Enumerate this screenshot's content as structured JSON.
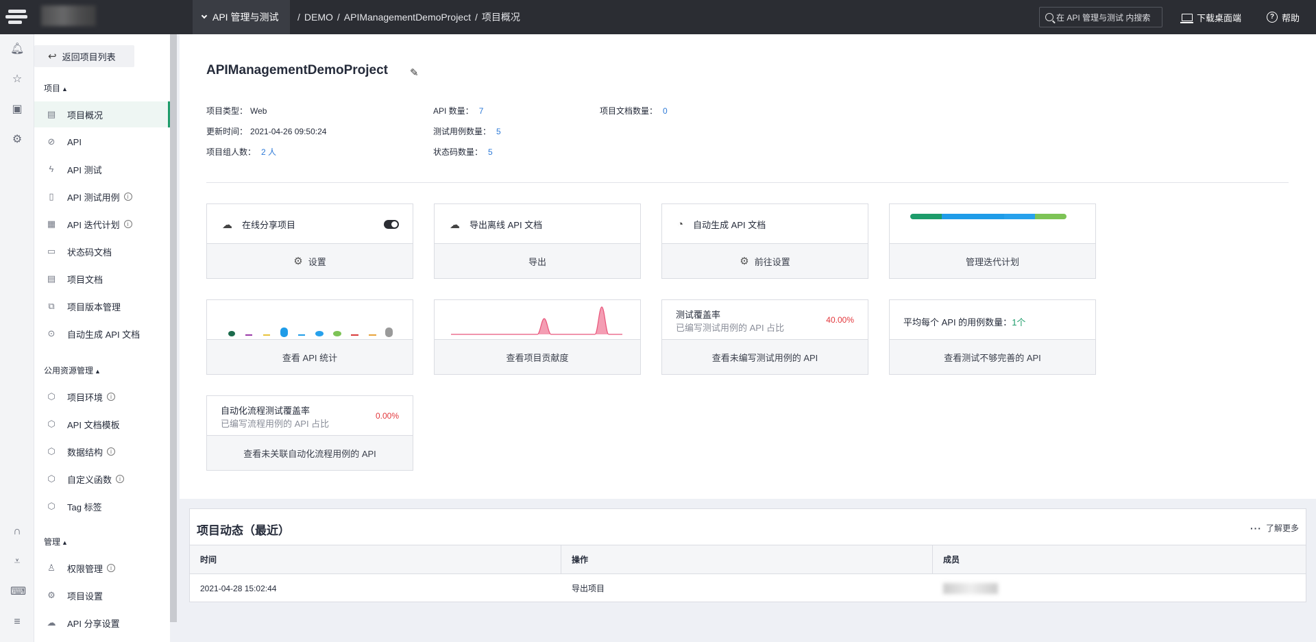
{
  "header": {
    "service": "API 管理与测试",
    "breadcrumb": [
      "DEMO",
      "APIManagementDemoProject",
      "项目概况"
    ],
    "search_placeholder": "在 API 管理与测试 内搜索",
    "download_label": "下载桌面端",
    "help_label": "帮助"
  },
  "rail_icons": [
    "bell-icon",
    "star-icon",
    "box-icon",
    "settings-icon",
    "headset-icon",
    "download-icon",
    "keyboard-icon",
    "menu-icon"
  ],
  "sidebar": {
    "back_label": "返回项目列表",
    "groups": [
      {
        "title": "项目",
        "items": [
          "项目概况",
          "API",
          "API 测试",
          "API 测试用例",
          "API 迭代计划",
          "状态码文档",
          "项目文档",
          "项目版本管理",
          "自动生成 API 文档"
        ]
      },
      {
        "title": "公用资源管理",
        "items": [
          "项目环境",
          "API 文档模板",
          "数据结构",
          "自定义函数",
          "Tag 标签"
        ]
      },
      {
        "title": "管理",
        "items": [
          "权限管理",
          "项目设置",
          "API 分享设置"
        ]
      }
    ],
    "active_item": "项目概况"
  },
  "project": {
    "name": "APIManagementDemoProject",
    "type_label": "项目类型：",
    "type_value": "Web",
    "updated_label": "更新时间：",
    "updated_value": "2021-04-26 09:50:24",
    "members_label": "项目组人数：",
    "members_value": "2 人",
    "api_count_label": "API 数量：",
    "api_count_value": "7",
    "case_count_label": "测试用例数量：",
    "case_count_value": "5",
    "status_count_label": "状态码数量：",
    "status_count_value": "5",
    "doc_count_label": "项目文档数量：",
    "doc_count_value": "0"
  },
  "cards": {
    "share": {
      "title": "在线分享项目",
      "action": "设置",
      "toggle_on": true
    },
    "export": {
      "title": "导出离线 API 文档",
      "action": "导出"
    },
    "autogen": {
      "title": "自动生成 API 文档",
      "action": "前往设置"
    },
    "iteration": {
      "action": "管理迭代计划",
      "segments": [
        {
          "color": "#1d9c6a",
          "share": 0.2
        },
        {
          "color": "#1f9ce8",
          "share": 0.4
        },
        {
          "color": "#27a1ec",
          "share": 0.2
        },
        {
          "color": "#7dc356",
          "share": 0.2
        }
      ]
    },
    "api_stats": {
      "action": "查看 API 统计"
    },
    "contribution": {
      "action": "查看项目贡献度"
    },
    "coverage": {
      "title": "测试覆盖率",
      "subtitle": "已编写测试用例的 API 占比",
      "value": "40.00%",
      "action": "查看未编写测试用例的 API"
    },
    "avg_cases": {
      "title": "平均每个 API 的用例数量：",
      "value": "1个",
      "action": "查看测试不够完善的 API"
    },
    "flow_coverage": {
      "title": "自动化流程测试覆盖率",
      "subtitle": "已编写流程用例的 API 占比",
      "value": "0.00%",
      "action": "查看未关联自动化流程用例的 API"
    }
  },
  "activity": {
    "title": "项目动态（最近）",
    "more_label": "了解更多",
    "columns": [
      "时间",
      "操作",
      "成员"
    ],
    "rows": [
      {
        "time": "2021-04-28 15:02:44",
        "action": "导出项目"
      }
    ]
  }
}
